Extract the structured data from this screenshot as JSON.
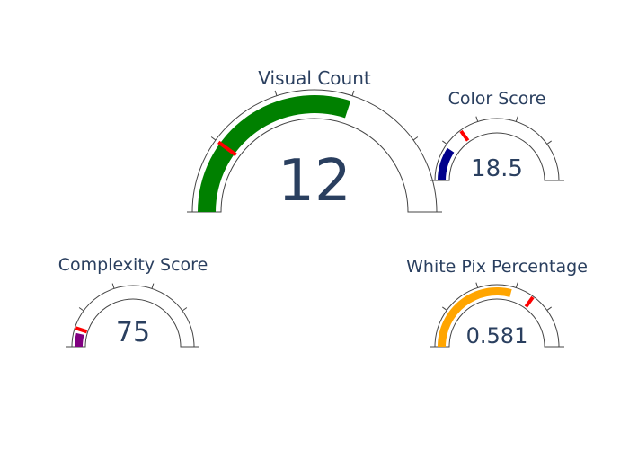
{
  "chart_data": [
    {
      "type": "gauge",
      "title": "Visual Count",
      "value": 12,
      "display_value": "12",
      "range": [
        0,
        20
      ],
      "threshold": 4,
      "bar_color": "#008000",
      "threshold_color": "#ff0000"
    },
    {
      "type": "gauge",
      "title": "Color Score",
      "value": 18.5,
      "display_value": "18.5",
      "range": [
        0,
        100
      ],
      "threshold": 30,
      "bar_color": "#00008b",
      "threshold_color": "#ff0000"
    },
    {
      "type": "gauge",
      "title": "Complexity Score",
      "value": 75,
      "display_value": "75",
      "range": [
        0,
        1000
      ],
      "threshold": 100,
      "bar_color": "#800080",
      "threshold_color": "#ff0000"
    },
    {
      "type": "gauge",
      "title": "White Pix Percentage",
      "value": 0.581,
      "display_value": "0.581",
      "range": [
        0,
        1
      ],
      "threshold": 0.7,
      "bar_color": "#ffa500",
      "threshold_color": "#ff0000"
    }
  ]
}
